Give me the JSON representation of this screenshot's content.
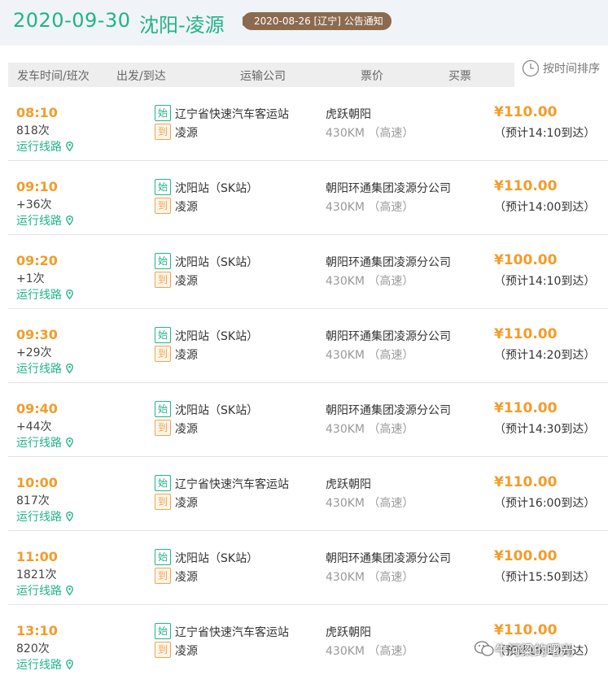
{
  "topbar": {
    "date": "2020-09-30",
    "route": "沈阳-凌源",
    "notice": "2020-08-26 [辽宁] 公告通知"
  },
  "header": {
    "col_time": "发车时间/班次",
    "col_route": "出发/到达",
    "col_company": "运输公司",
    "col_price": "票价",
    "col_buy": "买票",
    "sort_label": "按时间排序",
    "sort_icon": "clock-icon"
  },
  "badges": {
    "start": "始",
    "end": "到"
  },
  "route_link_label": "运行线路",
  "rows": [
    {
      "time": "08:10",
      "num": "818次",
      "from": "辽宁省快速汽车客运站",
      "to": "凌源",
      "company": "虎跃朝阳",
      "distance": "430KM （高速）",
      "price": "¥110.00",
      "arrive": "（预计14:10到达）"
    },
    {
      "time": "09:10",
      "num": "+36次",
      "from": "沈阳站（SK站）",
      "to": "凌源",
      "company": "朝阳环通集团凌源分公司",
      "distance": "430KM （高速）",
      "price": "¥110.00",
      "arrive": "（预计14:00到达）"
    },
    {
      "time": "09:20",
      "num": "+1次",
      "from": "沈阳站（SK站）",
      "to": "凌源",
      "company": "朝阳环通集团凌源分公司",
      "distance": "430KM （高速）",
      "price": "¥100.00",
      "arrive": "（预计14:10到达）"
    },
    {
      "time": "09:30",
      "num": "+29次",
      "from": "沈阳站（SK站）",
      "to": "凌源",
      "company": "朝阳环通集团凌源分公司",
      "distance": "430KM （高速）",
      "price": "¥110.00",
      "arrive": "（预计14:20到达）"
    },
    {
      "time": "09:40",
      "num": "+44次",
      "from": "沈阳站（SK站）",
      "to": "凌源",
      "company": "朝阳环通集团凌源分公司",
      "distance": "430KM （高速）",
      "price": "¥110.00",
      "arrive": "（预计14:30到达）"
    },
    {
      "time": "10:00",
      "num": "817次",
      "from": "辽宁省快速汽车客运站",
      "to": "凌源",
      "company": "虎跃朝阳",
      "distance": "430KM （高速）",
      "price": "¥110.00",
      "arrive": "（预计16:00到达）"
    },
    {
      "time": "11:00",
      "num": "1821次",
      "from": "沈阳站（SK站）",
      "to": "凌源",
      "company": "朝阳环通集团凌源分公司",
      "distance": "430KM （高速）",
      "price": "¥100.00",
      "arrive": "（预计15:50到达）"
    },
    {
      "time": "13:10",
      "num": "820次",
      "from": "辽宁省快速汽车客运站",
      "to": "凌源",
      "company": "虎跃朝阳",
      "distance": "430KM （高速）",
      "price": "¥110.00",
      "arrive": "（预计19:10到达）"
    }
  ],
  "watermark": {
    "text": "牛河粱的曙光"
  },
  "colors": {
    "accent": "#20b488",
    "price": "#f39c29",
    "notice_bg": "#8c6a4f"
  }
}
